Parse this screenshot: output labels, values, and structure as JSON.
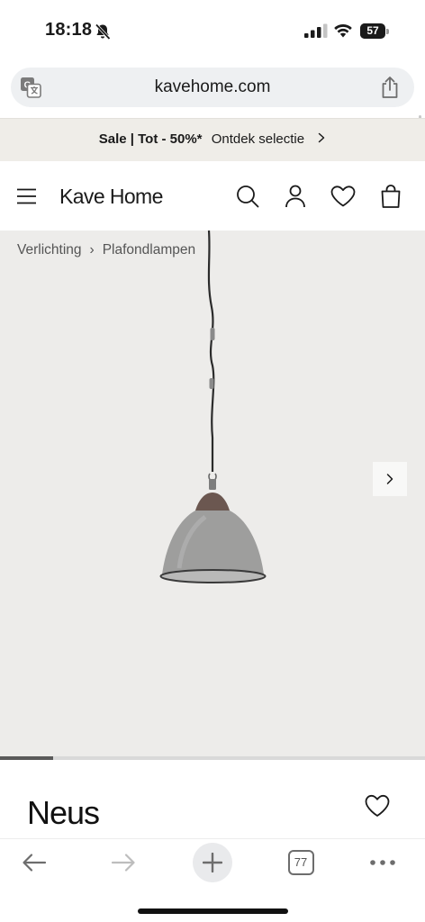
{
  "status_bar": {
    "time": "18:18",
    "battery": "57",
    "battery_level": 0.57
  },
  "browser": {
    "url": "kavehome.com",
    "tabs_count": "77"
  },
  "promo": {
    "bold": "Sale | Tot - 50%*",
    "link": "Ontdek selectie"
  },
  "nav": {
    "brand": "Kave Home"
  },
  "breadcrumb": {
    "items": [
      "Verlichting",
      "Plafondlampen"
    ]
  },
  "gallery": {
    "progress": 0.125
  },
  "product": {
    "title": "Neus"
  },
  "colors": {
    "promo_bg": "#efede8",
    "gallery_bg": "#edecea",
    "text": "#1a1a1a"
  },
  "icons": [
    "bell-off-icon",
    "signal-icon",
    "wifi-icon",
    "battery-icon",
    "translate-icon",
    "share-icon",
    "menu-icon",
    "search-icon",
    "account-icon",
    "heart-icon",
    "bag-icon",
    "chevron-right-icon",
    "back-arrow-icon",
    "forward-arrow-icon",
    "plus-icon",
    "tabs-icon",
    "more-icon"
  ]
}
